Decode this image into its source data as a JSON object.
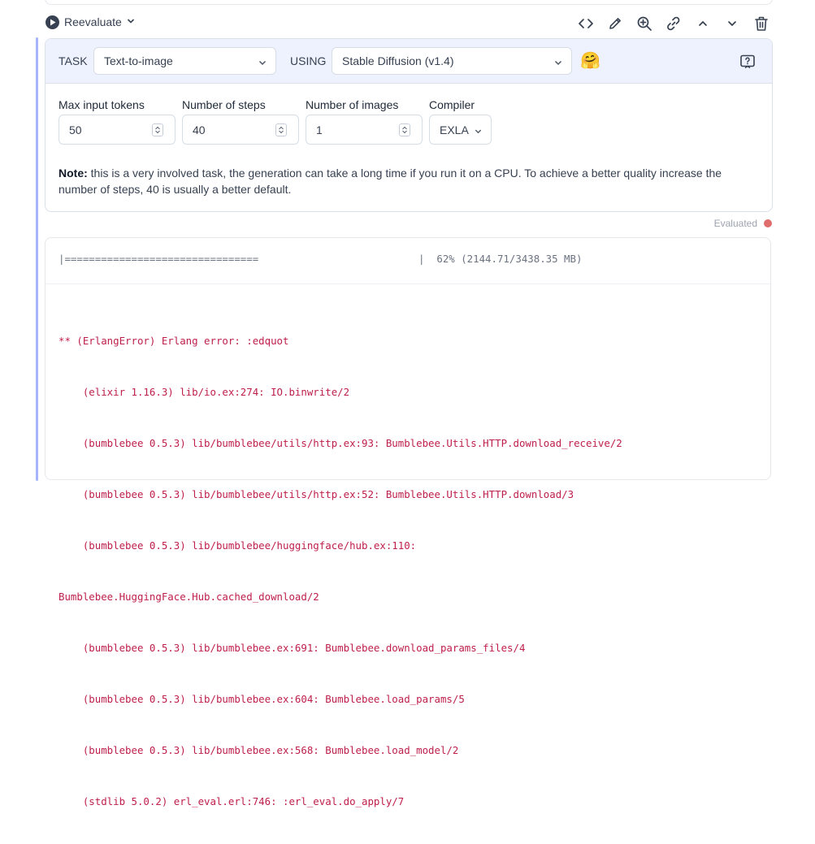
{
  "header": {
    "reevaluate_label": "Reevaluate",
    "toolbar_icons": [
      "code-icon",
      "pencil-icon",
      "zoom-in-icon",
      "link-icon",
      "chevron-up-icon",
      "chevron-down-icon",
      "trash-icon"
    ]
  },
  "task": {
    "task_label": "TASK",
    "task_value": "Text-to-image",
    "using_label": "USING",
    "using_value": "Stable Diffusion (v1.4)",
    "emoji": "🤗"
  },
  "fields": {
    "max_tokens": {
      "label": "Max input tokens",
      "value": "50"
    },
    "steps": {
      "label": "Number of steps",
      "value": "40"
    },
    "images": {
      "label": "Number of images",
      "value": "1"
    },
    "compiler": {
      "label": "Compiler",
      "value": "EXLA"
    }
  },
  "note": {
    "prefix": "Note:",
    "text": " this is a very involved task, the generation can take a long time if you run it on a CPU. To achieve a better quality increase the number of steps, 40 is usually a better default."
  },
  "status": {
    "label": "Evaluated",
    "color": "#e06c6c"
  },
  "output": {
    "progress_bar": "|================================",
    "progress_stats": "|  62% (2144.71/3438.35 MB)",
    "error_lines": [
      "** (ErlangError) Erlang error: :edquot",
      "    (elixir 1.16.3) lib/io.ex:274: IO.binwrite/2",
      "    (bumblebee 0.5.3) lib/bumblebee/utils/http.ex:93: Bumblebee.Utils.HTTP.download_receive/2",
      "    (bumblebee 0.5.3) lib/bumblebee/utils/http.ex:52: Bumblebee.Utils.HTTP.download/3",
      "    (bumblebee 0.5.3) lib/bumblebee/huggingface/hub.ex:110:",
      "Bumblebee.HuggingFace.Hub.cached_download/2",
      "    (bumblebee 0.5.3) lib/bumblebee.ex:691: Bumblebee.download_params_files/4",
      "    (bumblebee 0.5.3) lib/bumblebee.ex:604: Bumblebee.load_params/5",
      "    (bumblebee 0.5.3) lib/bumblebee.ex:568: Bumblebee.load_model/2",
      "    (stdlib 5.0.2) erl_eval.erl:746: :erl_eval.do_apply/7"
    ]
  }
}
